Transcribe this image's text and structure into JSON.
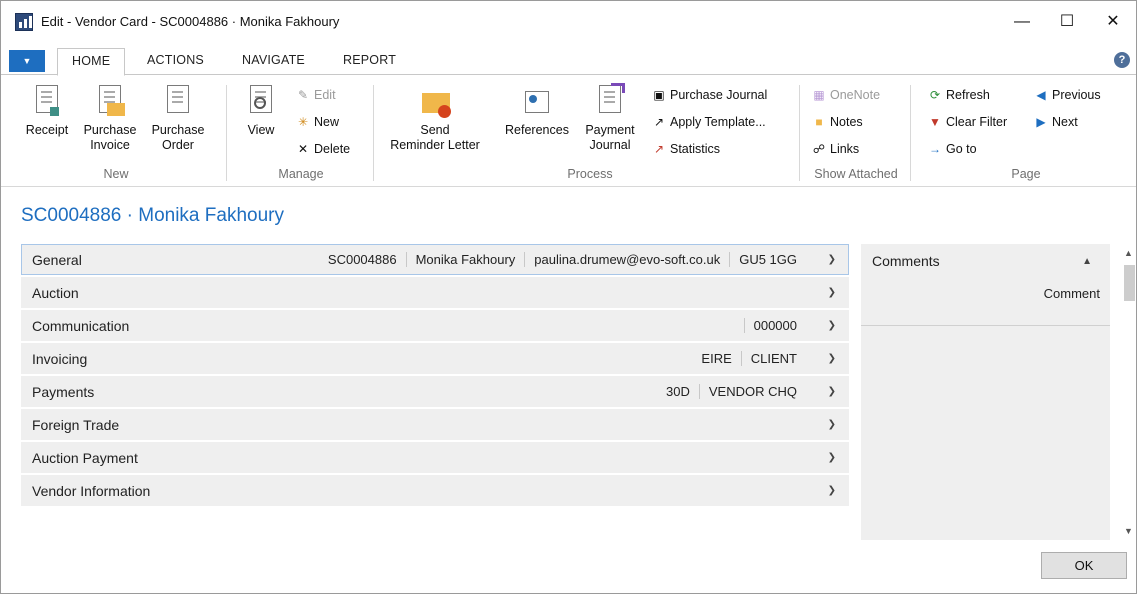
{
  "window": {
    "title": "Edit - Vendor Card - SC0004886 · Monika Fakhoury"
  },
  "tabs": [
    "HOME",
    "ACTIONS",
    "NAVIGATE",
    "REPORT"
  ],
  "ribbon": {
    "new": {
      "label": "New",
      "receipt": "Receipt",
      "purchase_invoice_1": "Purchase",
      "purchase_invoice_2": "Invoice",
      "purchase_order_1": "Purchase",
      "purchase_order_2": "Order"
    },
    "manage": {
      "label": "Manage",
      "view": "View",
      "edit": "Edit",
      "new": "New",
      "delete": "Delete"
    },
    "process": {
      "label": "Process",
      "send_1": "Send",
      "send_2": "Reminder Letter",
      "references": "References",
      "payment_journal_1": "Payment",
      "payment_journal_2": "Journal",
      "purchase_journal": "Purchase Journal",
      "apply_template": "Apply Template...",
      "statistics": "Statistics"
    },
    "show_attached": {
      "label": "Show Attached",
      "onenote": "OneNote",
      "notes": "Notes",
      "links": "Links"
    },
    "page": {
      "label": "Page",
      "refresh": "Refresh",
      "clear_filter": "Clear Filter",
      "go_to": "Go to",
      "previous": "Previous",
      "next": "Next"
    }
  },
  "page_title": "SC0004886 · Monika Fakhoury",
  "fasttabs": [
    {
      "name": "General",
      "values": [
        "SC0004886",
        "Monika Fakhoury",
        "paulina.drumew@evo-soft.co.uk",
        "GU5 1GG"
      ]
    },
    {
      "name": "Auction",
      "values": []
    },
    {
      "name": "Communication",
      "values": [
        "000000"
      ]
    },
    {
      "name": "Invoicing",
      "values": [
        "EIRE",
        "CLIENT"
      ]
    },
    {
      "name": "Payments",
      "values": [
        "30D",
        "VENDOR CHQ"
      ]
    },
    {
      "name": "Foreign Trade",
      "values": []
    },
    {
      "name": "Auction Payment",
      "values": []
    },
    {
      "name": "Vendor Information",
      "values": []
    }
  ],
  "factbox": {
    "title": "Comments",
    "column": "Comment"
  },
  "ok_label": "OK",
  "colors": {
    "accent": "#1e6ec0"
  }
}
